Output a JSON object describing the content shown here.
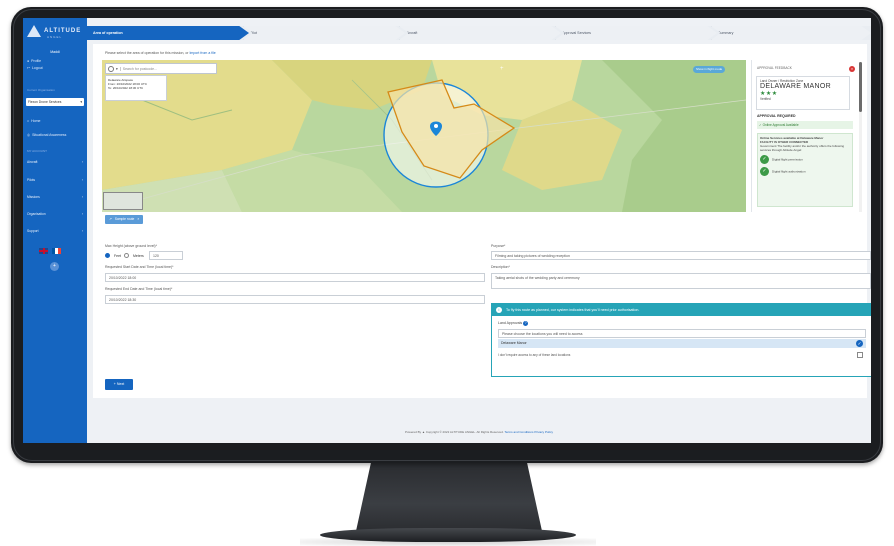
{
  "sidebar": {
    "logo_text": "ALTITUDE",
    "logo_sub": "ANGEL",
    "user_name": "Maddi",
    "profile_label": "Profile",
    "logout_label": "Logout",
    "section_organisation": "Current Organisation",
    "org_select": "Flexon Drone Services",
    "dashboard_label": "Home",
    "situational_label": "Situational Awareness",
    "section_manage": "MY ACCOUNT",
    "items": [
      {
        "label": "Aircraft"
      },
      {
        "label": "Pilots"
      },
      {
        "label": "Missions"
      },
      {
        "label": "Organisation"
      },
      {
        "label": "Support"
      }
    ],
    "help_icon": "help-icon"
  },
  "stepper": {
    "steps": [
      "Area of operation",
      "Pilot",
      "Aircraft",
      "Approval Services",
      "Summary"
    ]
  },
  "main": {
    "instruction": "Please select the area of operation for this mission, or",
    "instruction_link": "Import from a file",
    "search_placeholder": "Search for postcode...",
    "popup": {
      "title": "Delaware Airspace",
      "from": "From: 20/10/2022 18:00 UTC",
      "to": "To: 20/10/2022 18:30 UTC"
    },
    "map_pill_1": "Show in flight mode",
    "sample_route": "Sample route",
    "max_height_label": "Max Height (above ground level)*",
    "feet_label": "Feet",
    "meters_label": "Meters",
    "max_height_value": "120",
    "start_label": "Requested Start Date and Time (local time)*",
    "start_value": "20/10/2022 18:00",
    "end_label": "Requested End Date and Time (local time)*",
    "end_value": "20/10/2022 18:30",
    "purpose_label": "Purpose*",
    "purpose_value": "Filming and taking pictures of wedding reception",
    "description_label": "Description*",
    "description_value": "Taking aerial shots of the wedding party and ceremony",
    "alert_text": "To fly this route as planned, our system indicates that you'll need prior authorisation.",
    "land_approvals_label": "Land Approvals",
    "land_select_placeholder": "Please choose the locations you will need to access",
    "land_option": "Delaware Manor",
    "no_land_access": "I don't require access to any of these land locations",
    "next_label": "Next"
  },
  "right_panel": {
    "header": "APPROVAL FEEDBACK",
    "zone_type": "Land Owner / Restriction Zone",
    "zone_name": "DELAWARE MANOR",
    "rating": "★★★",
    "rating_sub": "Verified",
    "approval_title": "APPROVAL REQUIRED",
    "online_label": "Online Approval Available",
    "note_title": "Online Services available at Delaware Manor",
    "note_sub": "FACILITY IS OTHER CONNECTED",
    "note_body": "Government The facility and/or the authority offers the following services through Altitude Angel:",
    "service_1": "Digital flight permission",
    "service_2": "Digital flight authorization"
  },
  "footer": {
    "powered": "Powered By",
    "copyright": "Copyright © 2022 ALTITUDE ANGEL. All Rights Reserved.",
    "terms": "Terms and Conditions",
    "privacy": "Privacy Policy"
  }
}
